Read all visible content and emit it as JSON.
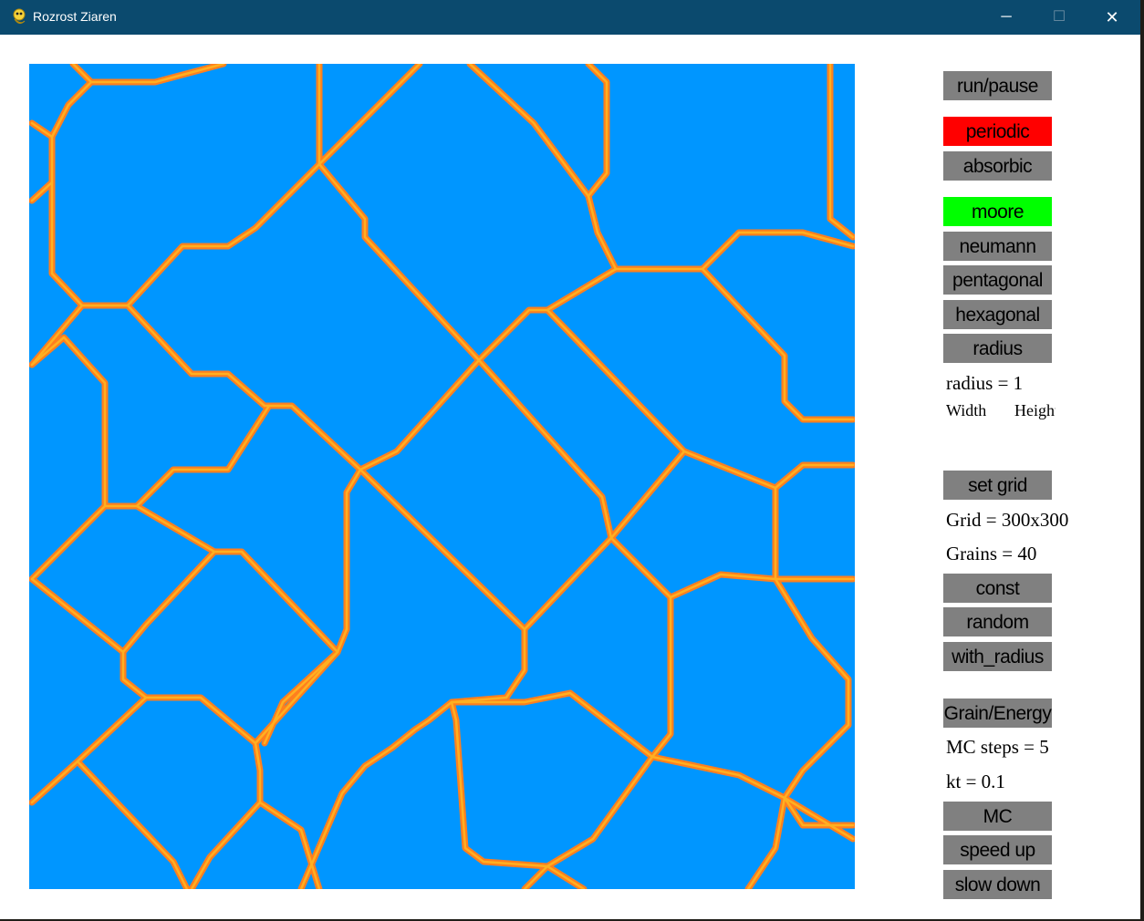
{
  "window": {
    "title": "Rozrost Ziaren",
    "minimize_glyph": "─",
    "maximize_glyph": "☐",
    "close_glyph": "✕"
  },
  "colors": {
    "grain": "#0096ff",
    "boundary_outer": "#ff7f1e",
    "boundary_inner": "#ffb020",
    "active_red": "#ff0000",
    "active_green": "#00ff00",
    "button": "#808080"
  },
  "controls": {
    "run_pause": "run/pause",
    "boundary": {
      "periodic": "periodic",
      "absorbic": "absorbic",
      "selected": "periodic"
    },
    "neighbourhood": {
      "moore": "moore",
      "neumann": "neumann",
      "pentagonal": "pentagonal",
      "hexagonal": "hexagonal",
      "radius": "radius",
      "selected": "moore"
    },
    "radius_text": "radius = 1",
    "width_label": "Width",
    "height_label": "Height",
    "set_grid": "set grid",
    "grid_text": "Grid = 300x300",
    "grains_text": "Grains = 40",
    "const": "const",
    "random": "random",
    "with_radius": "with_radius",
    "grain_energy": "Grain/Energy",
    "mc_steps_text": "MC steps = 5",
    "kt_text": "kt = 0.1",
    "mc": "MC",
    "speed_up": "speed up",
    "slow_down": "slow down"
  }
}
